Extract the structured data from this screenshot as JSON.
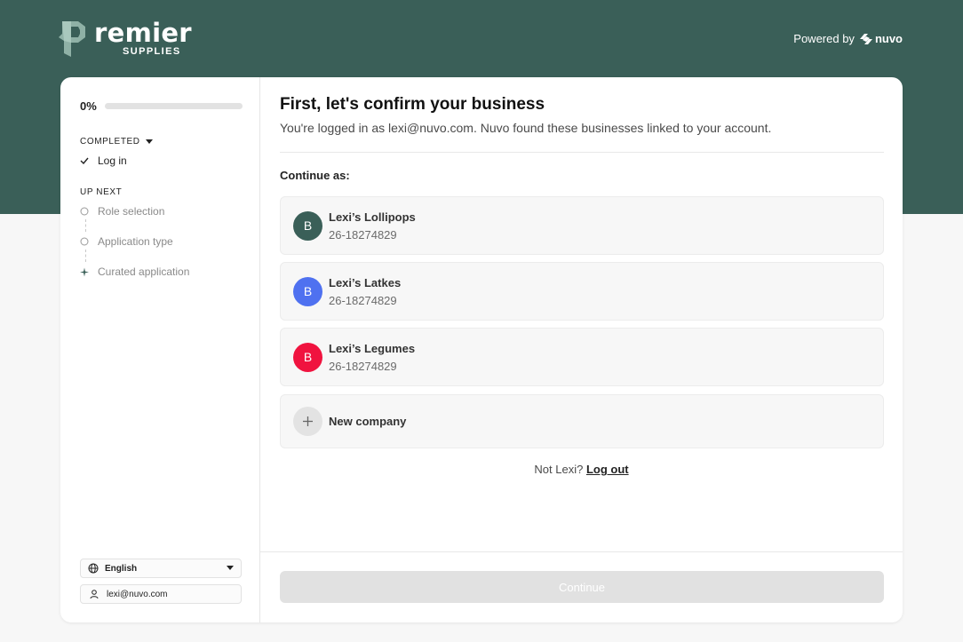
{
  "brand": {
    "logo_word": "remier",
    "logo_sub": "SUPPLIES",
    "logo_letter": "P",
    "powered_by": "Powered by",
    "powered_brand": "nuvo",
    "primary_color": "#3a5f58"
  },
  "sidebar": {
    "progress_label": "0%",
    "progress_value": 0,
    "completed_label": "COMPLETED",
    "completed_steps": [
      {
        "label": "Log in",
        "icon": "check-icon"
      }
    ],
    "upnext_label": "UP NEXT",
    "upnext_steps": [
      {
        "label": "Role selection",
        "icon": "circle-icon"
      },
      {
        "label": "Application type",
        "icon": "circle-icon"
      },
      {
        "label": "Curated application",
        "icon": "sparkle-icon"
      }
    ],
    "language": "English",
    "user_email": "lexi@nuvo.com"
  },
  "main": {
    "title": "First, let's confirm your business",
    "subtitle": "You're logged in as lexi@nuvo.com. Nuvo found these businesses linked to your account.",
    "continue_as": "Continue as:",
    "businesses": [
      {
        "avatar": "B",
        "name": "Lexi’s Lollipops",
        "id": "26-18274829",
        "color": "#3a5f58"
      },
      {
        "avatar": "B",
        "name": "Lexi’s Latkes",
        "id": "26-18274829",
        "color": "#4f71f0"
      },
      {
        "avatar": "B",
        "name": "Lexi’s Legumes",
        "id": "26-18274829",
        "color": "#f0133f"
      }
    ],
    "new_company": "New company",
    "not_user": "Not Lexi?",
    "logout": "Log out",
    "continue_button": "Continue"
  }
}
